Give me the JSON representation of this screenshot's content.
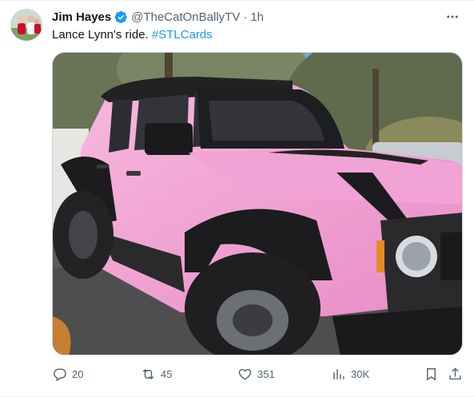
{
  "tweet": {
    "display_name": "Jim Hayes",
    "handle": "@TheCatOnBallyTV",
    "separator": "·",
    "timestamp": "1h",
    "text": "Lance Lynn's ride.",
    "hashtag": "#STLCards"
  },
  "actions": {
    "replies": "20",
    "reposts": "45",
    "likes": "351",
    "views": "30K"
  },
  "colors": {
    "accent": "#1d9bf0",
    "secondary_text": "#536471",
    "vehicle": "#f4a9d8"
  },
  "icons": [
    "verified-badge-icon",
    "more-icon",
    "reply-icon",
    "repost-icon",
    "like-icon",
    "views-icon",
    "bookmark-icon",
    "share-icon"
  ]
}
